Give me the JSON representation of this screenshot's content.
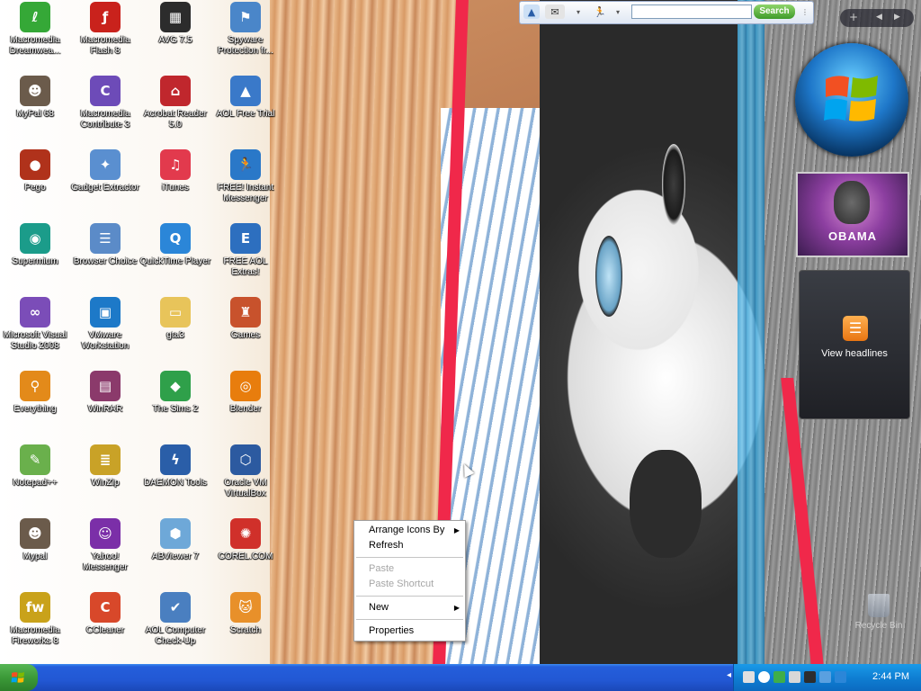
{
  "desktop_icons": [
    {
      "label": "Macromedia Dreamwea...",
      "icon": "dreamweaver-icon",
      "color": "#35a837",
      "glyph": "ℓ"
    },
    {
      "label": "Macromedia Flash 8",
      "icon": "flash-icon",
      "color": "#c9221c",
      "glyph": "ƒ"
    },
    {
      "label": "AVG 7.5",
      "icon": "avg-icon",
      "color": "#2c2c2c",
      "glyph": "▦"
    },
    {
      "label": "Spyware Protection fr...",
      "icon": "spyware-protection-icon",
      "color": "#4a86c9",
      "glyph": "⚑"
    },
    {
      "label": "MyPal 68",
      "icon": "mypal-icon",
      "color": "#6b5b4b",
      "glyph": "☻"
    },
    {
      "label": "Macromedia Contribute 3",
      "icon": "contribute-icon",
      "color": "#6d4bb8",
      "glyph": "C"
    },
    {
      "label": "Acrobat Reader 5.0",
      "icon": "acrobat-icon",
      "color": "#c0272d",
      "glyph": "⌂"
    },
    {
      "label": "AOL Free Trial",
      "icon": "aol-icon",
      "color": "#3a79c9",
      "glyph": "▲"
    },
    {
      "label": "Pego",
      "icon": "pego-icon",
      "color": "#b0321b",
      "glyph": "●"
    },
    {
      "label": "Gadget Extractor",
      "icon": "gadget-extractor-icon",
      "color": "#5a8fd0",
      "glyph": "✦"
    },
    {
      "label": "iTunes",
      "icon": "itunes-icon",
      "color": "#e23a4d",
      "glyph": "♫"
    },
    {
      "label": "FREE! Instant Messenger",
      "icon": "instant-messenger-icon",
      "color": "#2a78c8",
      "glyph": "🏃"
    },
    {
      "label": "Supermium",
      "icon": "supermium-icon",
      "color": "#1b9c8a",
      "glyph": "◉"
    },
    {
      "label": "Browser Choice",
      "icon": "browser-choice-icon",
      "color": "#5b8bc8",
      "glyph": "☰"
    },
    {
      "label": "QuickTime Player",
      "icon": "quicktime-icon",
      "color": "#2b86d8",
      "glyph": "Q"
    },
    {
      "label": "FREE AOL Extras!",
      "icon": "aol-extras-icon",
      "color": "#2d6fbf",
      "glyph": "E"
    },
    {
      "label": "Microsoft Visual Studio 2008",
      "icon": "visual-studio-icon",
      "color": "#7b4db8",
      "glyph": "∞"
    },
    {
      "label": "VMware Workstation",
      "icon": "vmware-icon",
      "color": "#1d79c8",
      "glyph": "▣"
    },
    {
      "label": "gta3",
      "icon": "folder-icon",
      "color": "#e8c45a",
      "glyph": "▭"
    },
    {
      "label": "Games",
      "icon": "games-icon",
      "color": "#c8522c",
      "glyph": "♜"
    },
    {
      "label": "Everything",
      "icon": "everything-icon",
      "color": "#e38a1a",
      "glyph": "⚲"
    },
    {
      "label": "WinRAR",
      "icon": "winrar-icon",
      "color": "#8b3a6b",
      "glyph": "▤"
    },
    {
      "label": "The Sims 2",
      "icon": "sims2-icon",
      "color": "#2fa04a",
      "glyph": "◆"
    },
    {
      "label": "Blender",
      "icon": "blender-icon",
      "color": "#e87d0d",
      "glyph": "◎"
    },
    {
      "label": "Notepad++",
      "icon": "notepad-plus-plus-icon",
      "color": "#6ab04c",
      "glyph": "✎"
    },
    {
      "label": "WinZip",
      "icon": "winzip-icon",
      "color": "#c9a227",
      "glyph": "≣"
    },
    {
      "label": "DAEMON Tools",
      "icon": "daemon-tools-icon",
      "color": "#2a5ea8",
      "glyph": "ϟ"
    },
    {
      "label": "Oracle VM VirtualBox",
      "icon": "virtualbox-icon",
      "color": "#2c5aa0",
      "glyph": "⬡"
    },
    {
      "label": "Mypal",
      "icon": "mypal-icon",
      "color": "#6b5b4b",
      "glyph": "☻"
    },
    {
      "label": "Yahoo! Messenger",
      "icon": "yahoo-messenger-icon",
      "color": "#7b2fa8",
      "glyph": "☺"
    },
    {
      "label": "ABViewer 7",
      "icon": "abviewer-icon",
      "color": "#6ea8d8",
      "glyph": "⬢"
    },
    {
      "label": "COREL.COM",
      "icon": "corel-icon",
      "color": "#d0302a",
      "glyph": "✺"
    },
    {
      "label": "Macromedia Fireworks 8",
      "icon": "fireworks-icon",
      "color": "#c9a21a",
      "glyph": "fw"
    },
    {
      "label": "CCleaner",
      "icon": "ccleaner-icon",
      "color": "#d8482a",
      "glyph": "C"
    },
    {
      "label": "AOL Computer Check-Up",
      "icon": "aol-check-up-icon",
      "color": "#4a7fc0",
      "glyph": "✔"
    },
    {
      "label": "Scratch",
      "icon": "scratch-icon",
      "color": "#e8902a",
      "glyph": "🐱"
    }
  ],
  "toolbar": {
    "search_placeholder": "",
    "search_button": "Search"
  },
  "sidebar": {
    "controls": {
      "add": "+",
      "prev": "◀",
      "next": "▶"
    },
    "news_tile_title": "OBAMA",
    "feed_label": "View headlines"
  },
  "recycle_bin": {
    "label": "Recycle Bin"
  },
  "context_menu": {
    "items": [
      {
        "label": "Arrange Icons By",
        "submenu": true,
        "enabled": true
      },
      {
        "label": "Refresh",
        "submenu": false,
        "enabled": true
      },
      {
        "separator": true
      },
      {
        "label": "Paste",
        "submenu": false,
        "enabled": false
      },
      {
        "label": "Paste Shortcut",
        "submenu": false,
        "enabled": false
      },
      {
        "separator": true
      },
      {
        "label": "New",
        "submenu": true,
        "enabled": true
      },
      {
        "separator": true
      },
      {
        "label": "Properties",
        "submenu": false,
        "enabled": true
      }
    ]
  },
  "taskbar": {
    "clock": "2:44 PM",
    "tray_icons": [
      "speaker-icon",
      "network-icon",
      "update-icon",
      "antivirus-icon",
      "security-icon",
      "messenger-icon",
      "quicktime-tray-icon"
    ]
  },
  "colors": {
    "taskbar": "#245edb",
    "start": "#3c9a38",
    "tray": "#0f7fd3"
  }
}
